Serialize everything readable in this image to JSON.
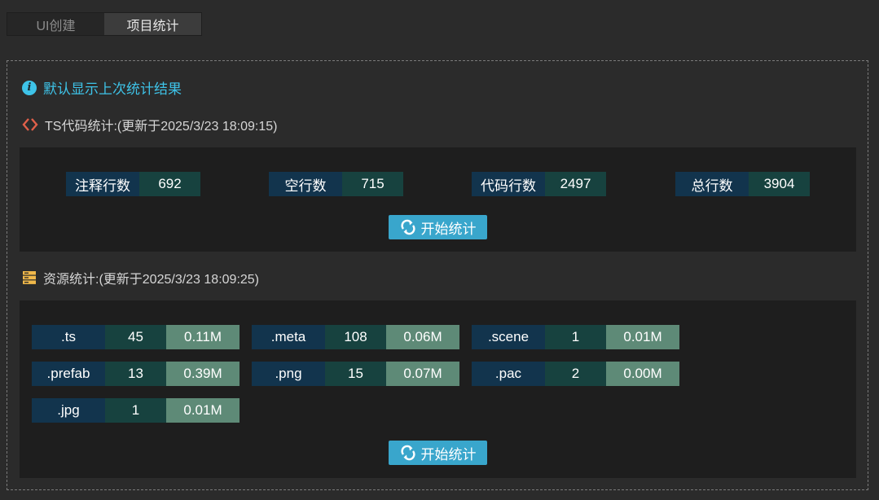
{
  "tabs": [
    {
      "label": "UI创建",
      "active": false
    },
    {
      "label": "项目统计",
      "active": true
    }
  ],
  "info": {
    "text": "默认显示上次统计结果",
    "icon": "info-icon",
    "color": "#3ec3e8"
  },
  "ts_section": {
    "title": "TS代码统计:(更新于2025/3/23 18:09:15)",
    "icon": "code-icon",
    "stats": [
      {
        "label": "注释行数",
        "value": "692"
      },
      {
        "label": "空行数",
        "value": "715"
      },
      {
        "label": "代码行数",
        "value": "2497"
      },
      {
        "label": "总行数",
        "value": "3904"
      }
    ],
    "button_label": "开始统计"
  },
  "res_section": {
    "title": "资源统计:(更新于2025/3/23 18:09:25)",
    "icon": "storage-icon",
    "items": [
      {
        "ext": ".ts",
        "count": "45",
        "size": "0.11M"
      },
      {
        "ext": ".meta",
        "count": "108",
        "size": "0.06M"
      },
      {
        "ext": ".scene",
        "count": "1",
        "size": "0.01M"
      },
      {
        "ext": ".prefab",
        "count": "13",
        "size": "0.39M"
      },
      {
        "ext": ".png",
        "count": "15",
        "size": "0.07M"
      },
      {
        "ext": ".pac",
        "count": "2",
        "size": "0.00M"
      },
      {
        "ext": ".jpg",
        "count": "1",
        "size": "0.01M"
      }
    ],
    "button_label": "开始统计"
  }
}
